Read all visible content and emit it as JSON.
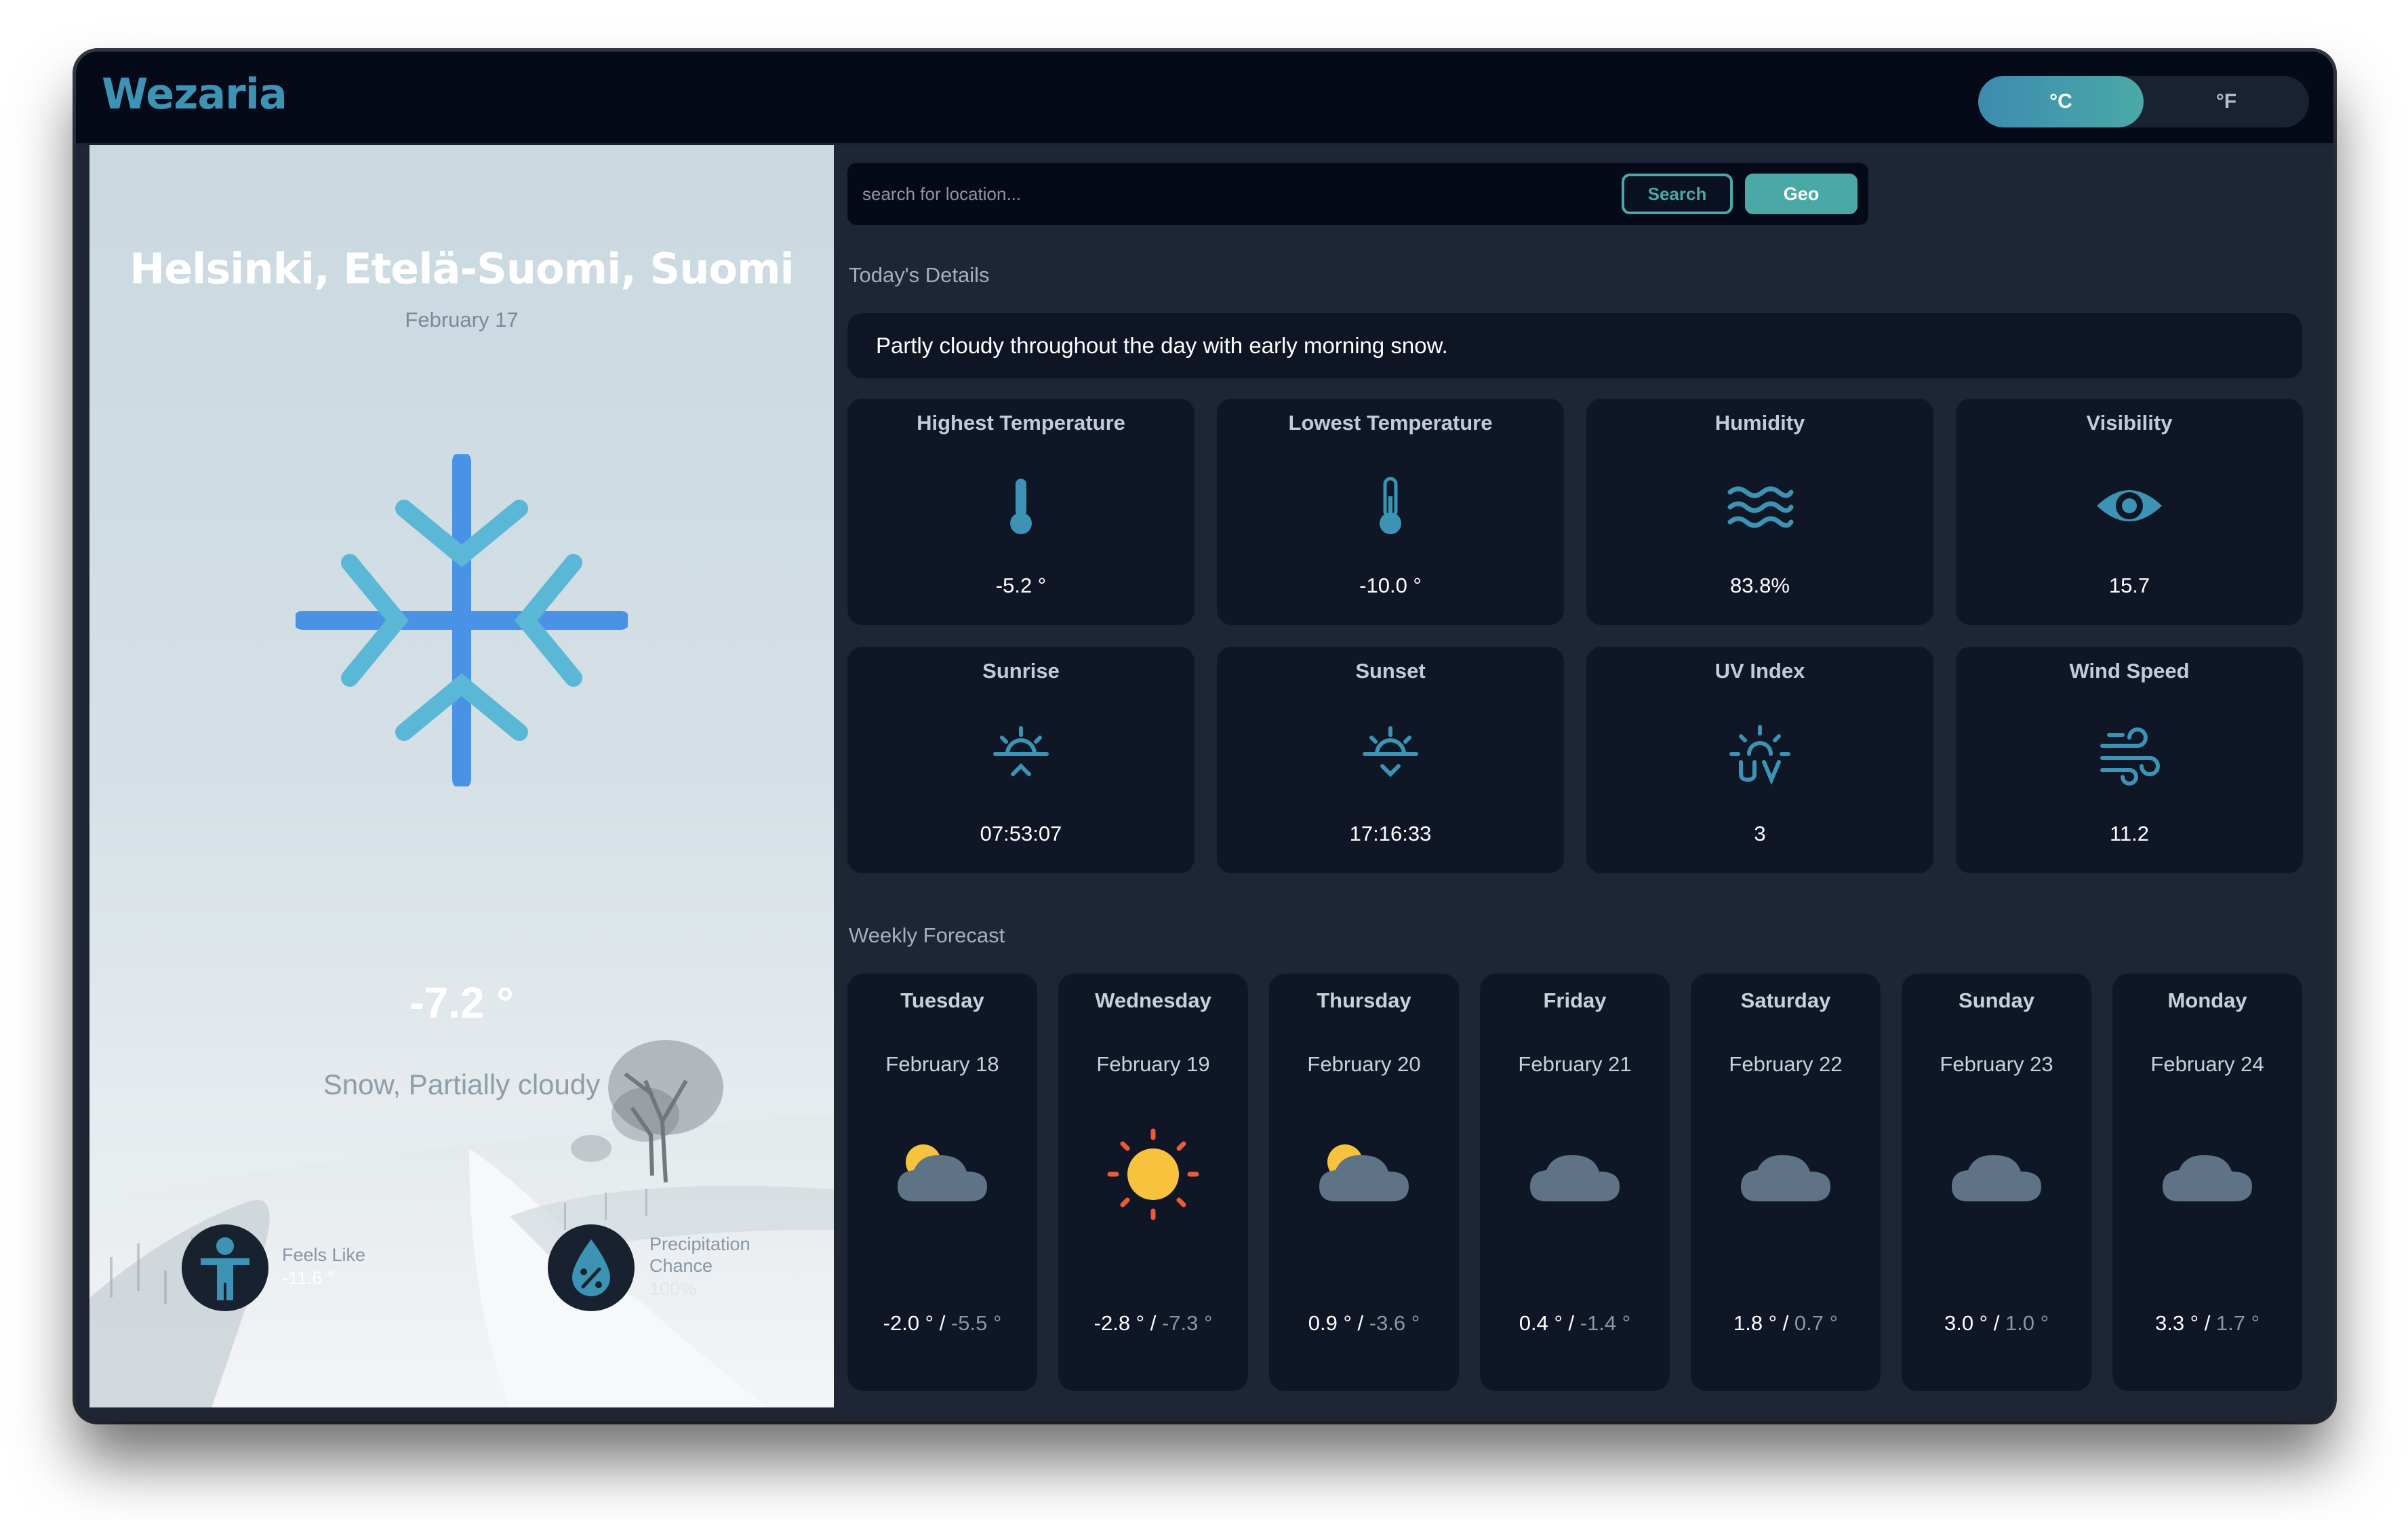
{
  "app": {
    "name": "Wezaria"
  },
  "units": {
    "celsius": "°C",
    "fahrenheit": "°F",
    "selected": "°C"
  },
  "current": {
    "location": "Helsinki, Etelä-Suomi, Suomi",
    "date": "February 17",
    "icon": "snowflake-icon",
    "temperature": "-7.2 °",
    "condition": "Snow, Partially cloudy",
    "feels_like_label": "Feels Like",
    "feels_like_value": "-11.6 °",
    "precip_label_1": "Precipitation",
    "precip_label_2": "Chance",
    "precip_value": "100%"
  },
  "search": {
    "placeholder": "search for location...",
    "search_label": "Search",
    "geo_label": "Geo"
  },
  "today": {
    "section_title": "Today's Details",
    "summary": "Partly cloudy throughout the day with early morning snow.",
    "cards": [
      {
        "title": "Highest Temperature",
        "value": "-5.2 °",
        "icon": "thermometer-icon"
      },
      {
        "title": "Lowest Temperature",
        "value": "-10.0 °",
        "icon": "thermometer-icon"
      },
      {
        "title": "Humidity",
        "value": "83.8%",
        "icon": "humidity-waves-icon"
      },
      {
        "title": "Visibility",
        "value": "15.7",
        "icon": "eye-icon"
      },
      {
        "title": "Sunrise",
        "value": "07:53:07",
        "icon": "sunrise-icon"
      },
      {
        "title": "Sunset",
        "value": "17:16:33",
        "icon": "sunset-icon"
      },
      {
        "title": "UV Index",
        "value": "3",
        "icon": "uv-index-icon"
      },
      {
        "title": "Wind Speed",
        "value": "11.2",
        "icon": "wind-icon"
      }
    ]
  },
  "weekly": {
    "section_title": "Weekly Forecast",
    "days": [
      {
        "day": "Tuesday",
        "date": "February 18",
        "high": "-2.0 °",
        "low": "-5.5 °",
        "icon": "partly-cloudy-icon"
      },
      {
        "day": "Wednesday",
        "date": "February 19",
        "high": "-2.8 °",
        "low": "-7.3 °",
        "icon": "sun-icon"
      },
      {
        "day": "Thursday",
        "date": "February 20",
        "high": "0.9 °",
        "low": "-3.6 °",
        "icon": "partly-cloudy-icon"
      },
      {
        "day": "Friday",
        "date": "February 21",
        "high": "0.4 °",
        "low": "-1.4 °",
        "icon": "cloud-icon"
      },
      {
        "day": "Saturday",
        "date": "February 22",
        "high": "1.8 °",
        "low": "0.7 °",
        "icon": "cloud-icon"
      },
      {
        "day": "Sunday",
        "date": "February 23",
        "high": "3.0 °",
        "low": "1.0 °",
        "icon": "cloud-icon"
      },
      {
        "day": "Monday",
        "date": "February 24",
        "high": "3.3 °",
        "low": "1.7 °",
        "icon": "cloud-icon"
      }
    ]
  },
  "colors": {
    "accent": "#4aa9a6",
    "accent_blue": "#3c8bb0",
    "icon_blue": "#3c93b4",
    "card_bg": "#0f1626",
    "panel_bg": "#1e2535"
  }
}
